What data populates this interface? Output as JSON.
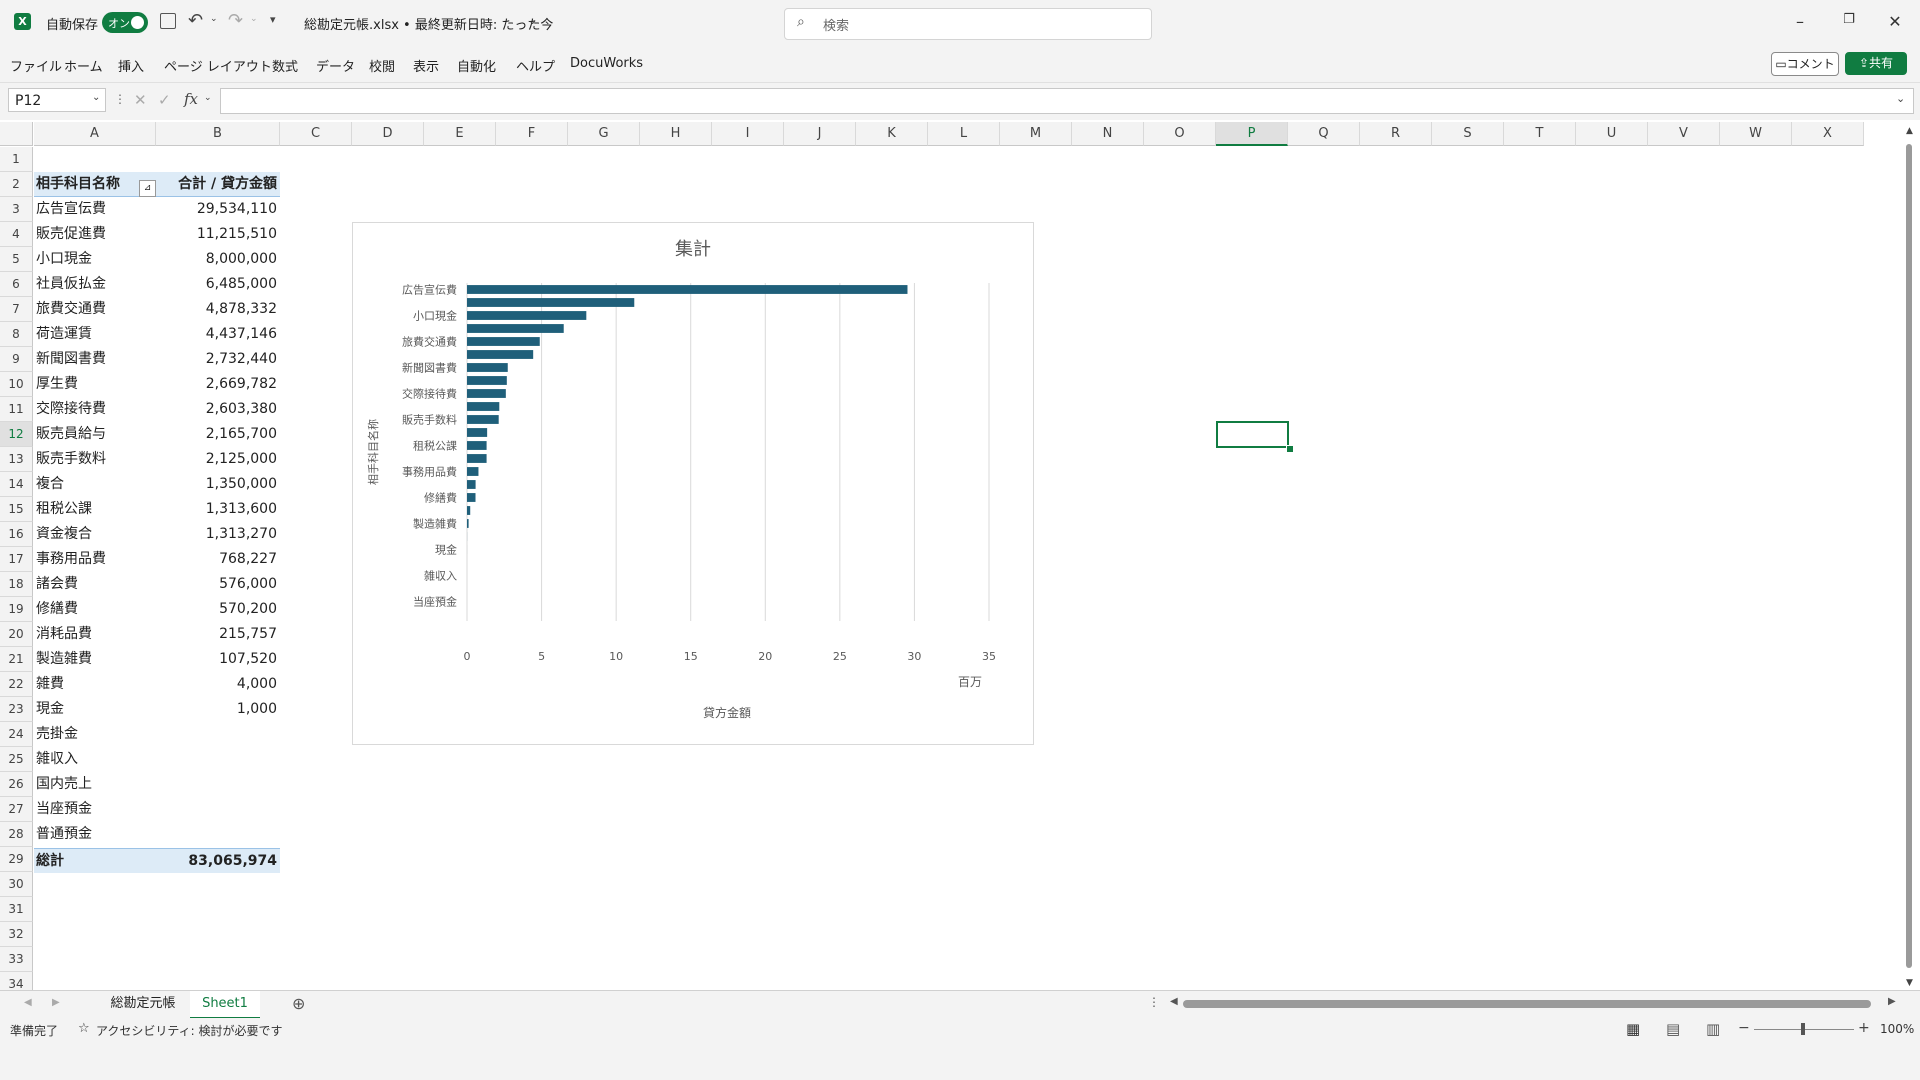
{
  "titlebar": {
    "autosave_label": "自動保存",
    "autosave_state": "オン",
    "file_title": "総勘定元帳.xlsx • 最終更新日時: たった今",
    "search_placeholder": "検索"
  },
  "menu": {
    "items": [
      "ファイル",
      "ホーム",
      "挿入",
      "ページ レイアウト",
      "数式",
      "データ",
      "校閲",
      "表示",
      "自動化",
      "ヘルプ",
      "DocuWorks"
    ],
    "comment_label": "コメント",
    "share_label": "共有"
  },
  "formula_bar": {
    "name_box": "P12",
    "fx": "fx",
    "value": ""
  },
  "columns": [
    "A",
    "B",
    "C",
    "D",
    "E",
    "F",
    "G",
    "H",
    "I",
    "J",
    "K",
    "L",
    "M",
    "N",
    "O",
    "P",
    "Q",
    "R",
    "S",
    "T",
    "U",
    "V",
    "W",
    "X"
  ],
  "active_column": "P",
  "rows": [
    "1",
    "2",
    "3",
    "4",
    "5",
    "6",
    "7",
    "8",
    "9",
    "10",
    "11",
    "12",
    "13",
    "14",
    "15",
    "16",
    "17",
    "18",
    "19",
    "20",
    "21",
    "22",
    "23",
    "24",
    "25",
    "26",
    "27",
    "28",
    "29",
    "30",
    "31",
    "32",
    "33",
    "34"
  ],
  "active_row": "12",
  "pivot": {
    "header_label": "相手科目名称",
    "header_value": "合計 / 貸方金額",
    "rows": [
      {
        "label": "広告宣伝費",
        "value": "29,534,110"
      },
      {
        "label": "販売促進費",
        "value": "11,215,510"
      },
      {
        "label": "小口現金",
        "value": "8,000,000"
      },
      {
        "label": "社員仮払金",
        "value": "6,485,000"
      },
      {
        "label": "旅費交通費",
        "value": "4,878,332"
      },
      {
        "label": "荷造運賃",
        "value": "4,437,146"
      },
      {
        "label": "新聞図書費",
        "value": "2,732,440"
      },
      {
        "label": "厚生費",
        "value": "2,669,782"
      },
      {
        "label": "交際接待費",
        "value": "2,603,380"
      },
      {
        "label": "販売員給与",
        "value": "2,165,700"
      },
      {
        "label": "販売手数料",
        "value": "2,125,000"
      },
      {
        "label": "複合",
        "value": "1,350,000"
      },
      {
        "label": "租税公課",
        "value": "1,313,600"
      },
      {
        "label": "資金複合",
        "value": "1,313,270"
      },
      {
        "label": "事務用品費",
        "value": "768,227"
      },
      {
        "label": "諸会費",
        "value": "576,000"
      },
      {
        "label": "修繕費",
        "value": "570,200"
      },
      {
        "label": "消耗品費",
        "value": "215,757"
      },
      {
        "label": "製造雑費",
        "value": "107,520"
      },
      {
        "label": "雑費",
        "value": "4,000"
      },
      {
        "label": "現金",
        "value": "1,000"
      },
      {
        "label": "売掛金",
        "value": ""
      },
      {
        "label": "雑収入",
        "value": ""
      },
      {
        "label": "国内売上",
        "value": ""
      },
      {
        "label": "当座預金",
        "value": ""
      },
      {
        "label": "普通預金",
        "value": ""
      }
    ],
    "total_label": "総計",
    "total_value": "83,065,974"
  },
  "chart_data": {
    "type": "bar",
    "orientation": "horizontal",
    "title": "集計",
    "xlabel": "貸方金額",
    "ylabel": "相手科目名称",
    "unit_label": "百万",
    "xlim": [
      0,
      35
    ],
    "xticks": [
      "0",
      "5",
      "10",
      "15",
      "20",
      "25",
      "30",
      "35"
    ],
    "categories": [
      "広告宣伝費",
      "販売促進費",
      "小口現金",
      "社員仮払金",
      "旅費交通費",
      "荷造運賃",
      "新聞図書費",
      "厚生費",
      "交際接待費",
      "販売員給与",
      "販売手数料",
      "複合",
      "租税公課",
      "資金複合",
      "事務用品費",
      "諸会費",
      "修繕費",
      "消耗品費",
      "製造雑費",
      "雑費",
      "現金",
      "売掛金",
      "雑収入",
      "国内売上",
      "当座預金",
      "普通預金"
    ],
    "visible_category_labels": [
      "広告宣伝費",
      "小口現金",
      "旅費交通費",
      "新聞図書費",
      "交際接待費",
      "販売手数料",
      "租税公課",
      "事務用品費",
      "修繕費",
      "製造雑費",
      "現金",
      "雑収入",
      "当座預金"
    ],
    "values": [
      29.53411,
      11.21551,
      8.0,
      6.485,
      4.878332,
      4.437146,
      2.73244,
      2.669782,
      2.60338,
      2.1657,
      2.125,
      1.35,
      1.3136,
      1.31327,
      0.768227,
      0.576,
      0.5702,
      0.215757,
      0.10752,
      0.004,
      0.001,
      0,
      0,
      0,
      0,
      0
    ],
    "bar_color": "#1f5f7a",
    "grid": true,
    "legend": "none"
  },
  "tabs": {
    "sheets": [
      "総勘定元帳",
      "Sheet1"
    ],
    "active": "Sheet1"
  },
  "status": {
    "ready": "準備完了",
    "accessibility": "アクセシビリティ: 検討が必要です",
    "zoom": "100%"
  },
  "colors": {
    "accent": "#107c41",
    "pivot_header_bg": "#ddebf7",
    "bar": "#1f5f7a"
  }
}
